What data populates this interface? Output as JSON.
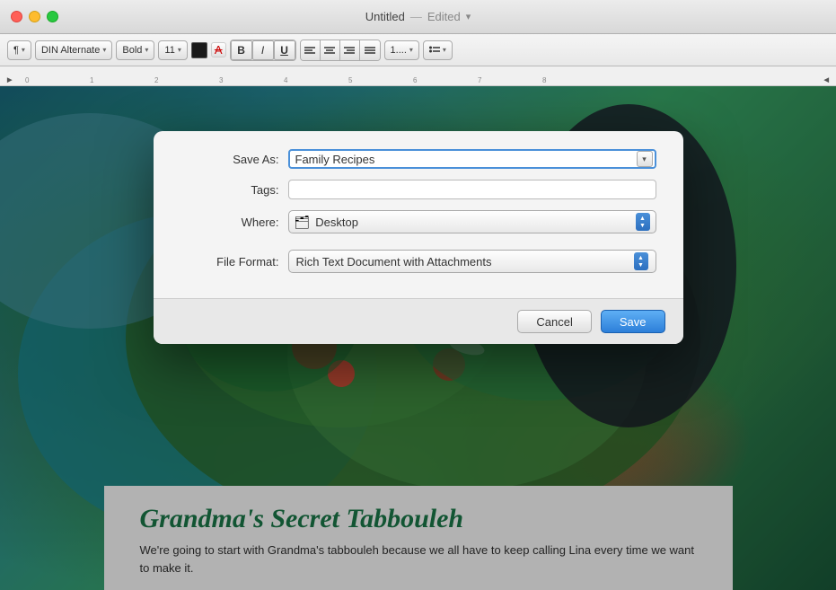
{
  "titleBar": {
    "title": "Untitled",
    "separator": "—",
    "status": "Edited",
    "dropdownArrow": "▾"
  },
  "toolbar": {
    "paragraphBtn": "¶",
    "fontFamily": "DIN Alternate",
    "fontWeight": "Bold",
    "fontSize": "11",
    "colorBoxLabel": "Text color",
    "strikeLabel": "Strikethrough",
    "boldLabel": "B",
    "italicLabel": "I",
    "underlineLabel": "U",
    "alignLeft": "≡",
    "alignCenter": "≡",
    "alignRight": "≡",
    "alignJustify": "≡",
    "listNumber": "1....",
    "listBullet": "≡"
  },
  "dialog": {
    "saveAsLabel": "Save As:",
    "saveAsValue": "Family Recipes",
    "saveAsPlaceholder": "Family Recipes",
    "tagsLabel": "Tags:",
    "tagsPlaceholder": "",
    "whereLabel": "Where:",
    "whereValue": "Desktop",
    "folderIcon": "🗂",
    "fileFormatLabel": "File Format:",
    "fileFormatValue": "Rich Text Document with Attachments",
    "cancelBtn": "Cancel",
    "saveBtn": "Save"
  },
  "document": {
    "recipeTitle": "Grandma's Secret Tabbouleh",
    "recipeSubtitle": "We're going to start with Grandma's tabbouleh because we all have to keep calling Lina every time we want to make it."
  }
}
